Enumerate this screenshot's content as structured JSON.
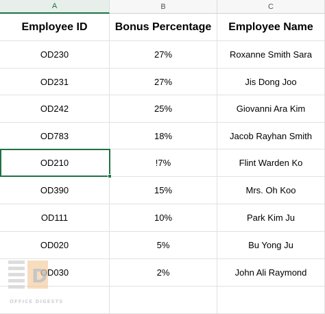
{
  "columns": [
    "A",
    "B",
    "C"
  ],
  "headers": [
    "Employee ID",
    "Bonus Percentage",
    "Employee Name"
  ],
  "rows": [
    [
      "OD230",
      "27%",
      "Roxanne Smith Sara"
    ],
    [
      "OD231",
      "27%",
      "Jis Dong Joo"
    ],
    [
      "OD242",
      "25%",
      "Giovanni Ara Kim"
    ],
    [
      "OD783",
      "18%",
      "Jacob Rayhan Smith"
    ],
    [
      "OD210",
      "!7%",
      "Flint Warden Ko"
    ],
    [
      "OD390",
      "15%",
      "Mrs. Oh Koo"
    ],
    [
      "OD111",
      "10%",
      "Park Kim Ju"
    ],
    [
      "OD020",
      "5%",
      "Bu Yong Ju"
    ],
    [
      "OD030",
      "2%",
      "John Ali Raymond"
    ]
  ],
  "watermark": {
    "text": "OFFICE DIGESTS",
    "logo_letter": "D"
  },
  "colors": {
    "accent": "#1e7145",
    "gridline": "#e1e1e1"
  }
}
